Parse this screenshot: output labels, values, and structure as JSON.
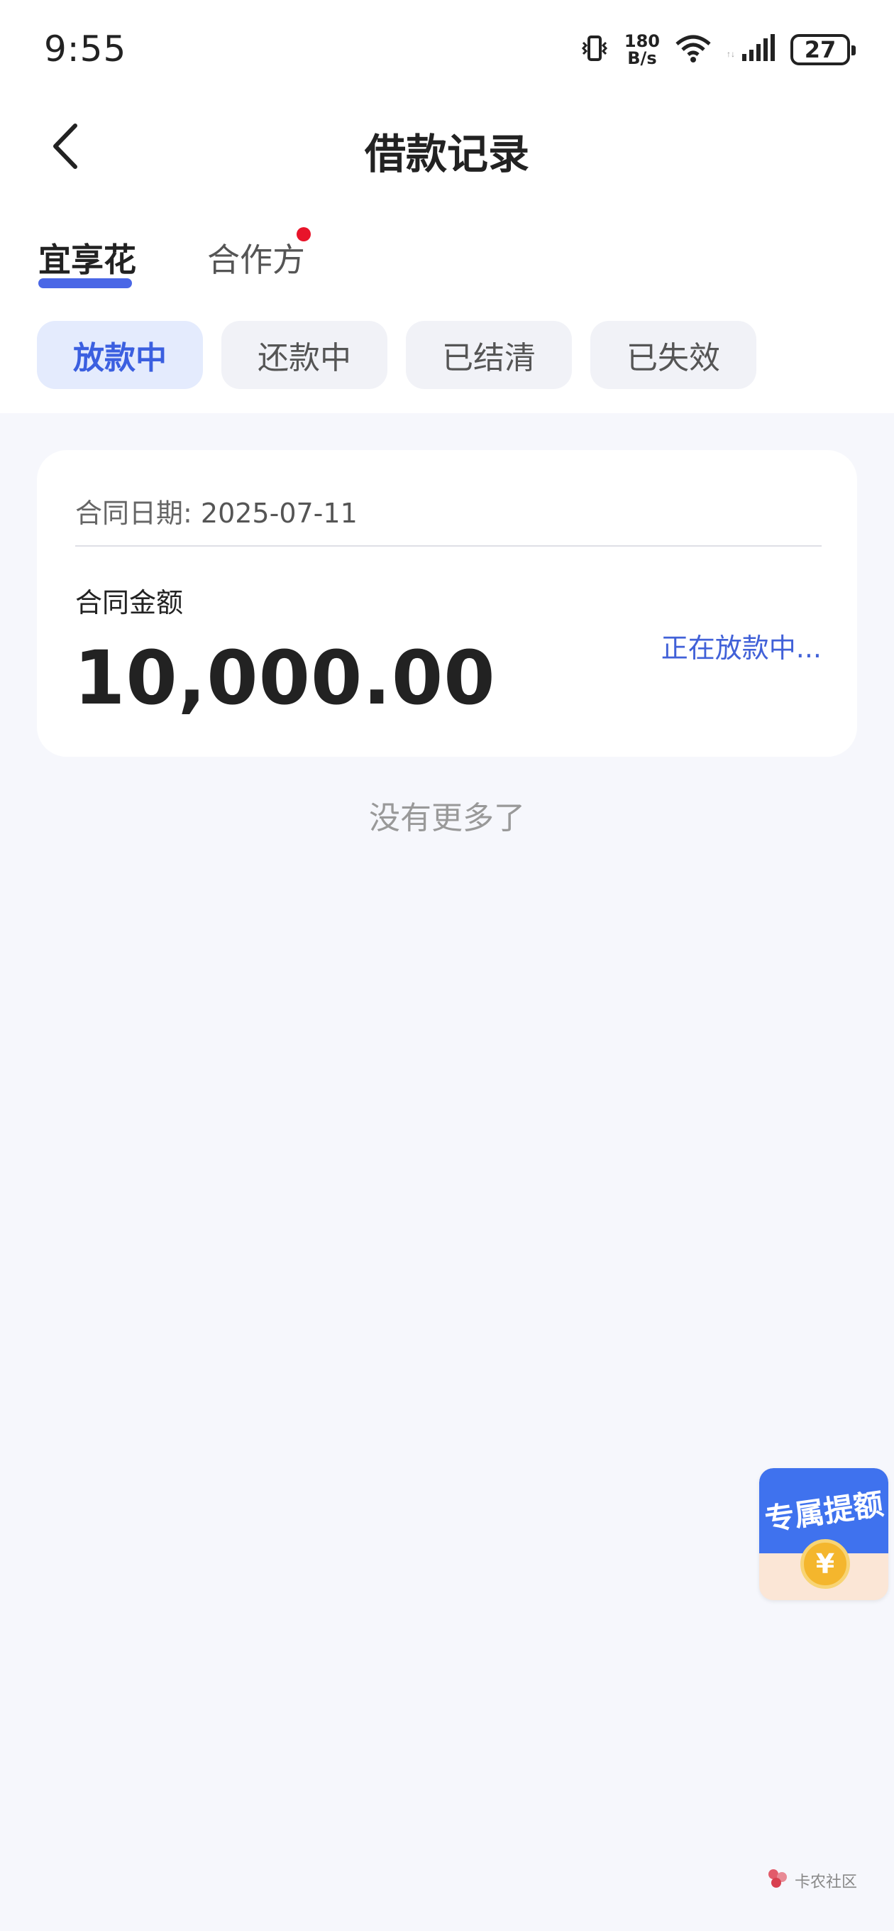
{
  "status_bar": {
    "time": "9:55",
    "net_speed_value": "180",
    "net_speed_unit": "B/s",
    "battery": "27"
  },
  "header": {
    "title": "借款记录"
  },
  "tabs": [
    {
      "label": "宜享花",
      "active": true
    },
    {
      "label": "合作方",
      "active": false,
      "has_dot": true
    }
  ],
  "filters": [
    {
      "label": "放款中",
      "active": true
    },
    {
      "label": "还款中",
      "active": false
    },
    {
      "label": "已结清",
      "active": false
    },
    {
      "label": "已失效",
      "active": false
    }
  ],
  "record": {
    "date_label": "合同日期:",
    "date_value": "2025-07-11",
    "amount_label": "合同金额",
    "amount_value": "10,000.00",
    "status": "正在放款中..."
  },
  "footer_hint": "没有更多了",
  "promo": {
    "label": "专属提额",
    "coin_symbol": "¥"
  },
  "watermark": {
    "text": "卡农社区"
  },
  "colors": {
    "accent": "#4a67e6",
    "status": "#4161d8",
    "dot": "#e8142a",
    "background": "#f6f7fc"
  }
}
